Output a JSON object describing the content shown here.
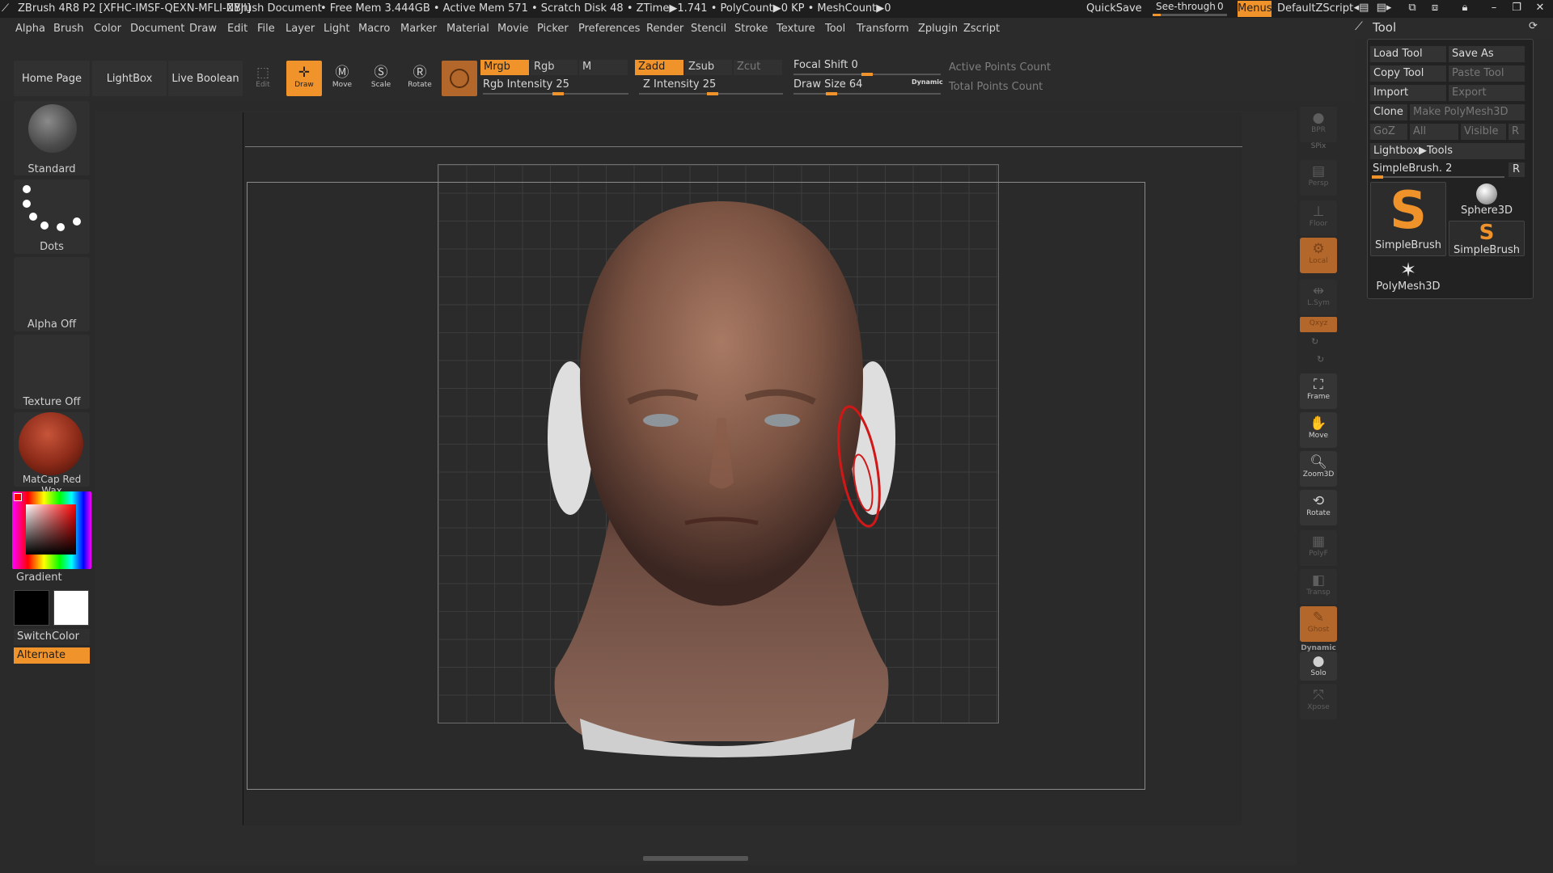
{
  "titlebar": {
    "app_title": "ZBrush 4R8 P2 [XFHC-IMSF-QEXN-MFLI-NYJI]",
    "document": "ZBrush Document",
    "stats": "• Free Mem 3.444GB • Active Mem 571 • Scratch Disk 48 • ZTime▶1.741 • PolyCount▶0 KP • MeshCount▶0",
    "quicksave": "QuickSave",
    "see_through_label": "See-through",
    "see_through_value": "0",
    "menus": "Menus",
    "script": "DefaultZScript"
  },
  "menubar": {
    "items": [
      "Alpha",
      "Brush",
      "Color",
      "Document",
      "Draw",
      "Edit",
      "File",
      "Layer",
      "Light",
      "Macro",
      "Marker",
      "Material",
      "Movie",
      "Picker",
      "Preferences",
      "Render",
      "Stencil",
      "Stroke",
      "Texture",
      "Tool",
      "Transform",
      "Zplugin",
      "Zscript"
    ]
  },
  "shelf": {
    "home_page": "Home Page",
    "lightbox": "LightBox",
    "live_boolean": "Live Boolean",
    "tools": [
      {
        "label": "Edit",
        "icon": "edit-icon"
      },
      {
        "label": "Draw",
        "icon": "draw-icon"
      },
      {
        "label": "Move",
        "icon": "move-icon"
      },
      {
        "label": "Scale",
        "icon": "scale-icon"
      },
      {
        "label": "Rotate",
        "icon": "rotate-icon"
      }
    ],
    "mrgb": "Mrgb",
    "rgb": "Rgb",
    "m": "M",
    "rgb_intensity_label": "Rgb Intensity 25",
    "zadd": "Zadd",
    "zsub": "Zsub",
    "zcut": "Zcut",
    "z_intensity_label": "Z Intensity 25",
    "focal_shift_label": "Focal Shift 0",
    "draw_size_label": "Draw Size 64",
    "dynamic": "Dynamic",
    "active_points": "Active Points Count",
    "total_points": "Total Points Count"
  },
  "left_panel": {
    "brush": "Standard",
    "stroke": "Dots",
    "alpha": "Alpha Off",
    "texture": "Texture Off",
    "material": "MatCap Red Wax",
    "gradient": "Gradient",
    "switch_color": "SwitchColor",
    "alternate": "Alternate"
  },
  "right_tray": {
    "bpr": "BPR",
    "spix": "SPix",
    "persp": "Persp",
    "floor": "Floor",
    "local": "Local",
    "lsym": "L.Sym",
    "xyz": "Qxyz",
    "frame": "Frame",
    "move": "Move",
    "zoom3d": "Zoom3D",
    "rotate": "Rotate",
    "polyf": "PolyF",
    "transp": "Transp",
    "ghost": "Ghost",
    "dynamic": "Dynamic",
    "solo": "Solo",
    "xpose": "Xpose"
  },
  "tool_panel": {
    "title": "Tool",
    "load_tool": "Load Tool",
    "save_as": "Save As",
    "copy_tool": "Copy Tool",
    "paste_tool": "Paste Tool",
    "import": "Import",
    "export": "Export",
    "clone": "Clone",
    "make_polymesh": "Make PolyMesh3D",
    "goz": "GoZ",
    "all": "All",
    "visible": "Visible",
    "r": "R",
    "lightbox_tools": "Lightbox▶Tools",
    "current_tool": "SimpleBrush. 2",
    "thumbs": [
      "SimpleBrush",
      "Sphere3D",
      "SimpleBrush",
      "PolyMesh3D"
    ]
  },
  "colors": {
    "accent": "#f0932a",
    "background": "#2a2a2a",
    "panel": "#303030"
  }
}
